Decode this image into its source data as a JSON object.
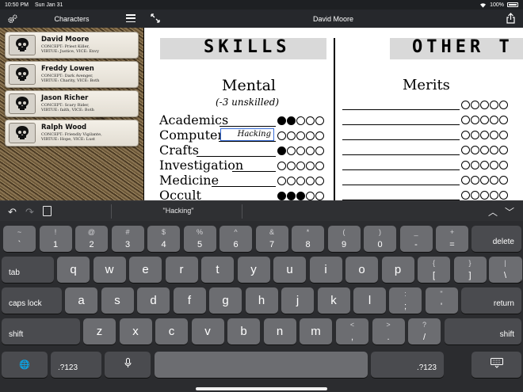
{
  "status_bar": {
    "time": "10:50 PM",
    "date": "Sun Jan 31",
    "battery": "100%"
  },
  "sidebar": {
    "title": "Characters",
    "characters": [
      {
        "name": "David Moore",
        "line1": "CONCEPT: Priest Killer,",
        "line2": "VIRTUE: Justice, VICE: Envy"
      },
      {
        "name": "Freddy Lowen",
        "line1": "CONCEPT: Dark Avenger,",
        "line2": "VIRTUE: Charity, VICE: Both"
      },
      {
        "name": "Jason Richer",
        "line1": "CONCEPT: Scary Rider,",
        "line2": "VIRTUE: faith, VICE: Both"
      },
      {
        "name": "Ralph Wood",
        "line1": "CONCEPT: Friendly Vigilante,",
        "line2": "VIRTUE: Hope, VICE: Lust"
      }
    ]
  },
  "main": {
    "title": "David Moore",
    "sheet": {
      "skills_banner": "SKILLS",
      "other_banner": "OTHER T",
      "mental_title": "Mental",
      "mental_subtitle": "(-3 unskilled)",
      "skills": [
        {
          "name": "Academics",
          "rating": 2
        },
        {
          "name": "Computer",
          "rating": 0,
          "specialty": "Hacking"
        },
        {
          "name": "Crafts",
          "rating": 1
        },
        {
          "name": "Investigation",
          "rating": 0
        },
        {
          "name": "Medicine",
          "rating": 0
        },
        {
          "name": "Occult",
          "rating": 3
        }
      ],
      "merits_title": "Merits",
      "merit_rows": 7
    }
  },
  "keyboard": {
    "suggestion": "\"Hacking\"",
    "row1": [
      {
        "top": "~",
        "bot": "`"
      },
      {
        "top": "!",
        "bot": "1"
      },
      {
        "top": "@",
        "bot": "2"
      },
      {
        "top": "#",
        "bot": "3"
      },
      {
        "top": "$",
        "bot": "4"
      },
      {
        "top": "%",
        "bot": "5"
      },
      {
        "top": "^",
        "bot": "6"
      },
      {
        "top": "&",
        "bot": "7"
      },
      {
        "top": "*",
        "bot": "8"
      },
      {
        "top": "(",
        "bot": "9"
      },
      {
        "top": ")",
        "bot": "0"
      },
      {
        "top": "_",
        "bot": "-"
      },
      {
        "top": "+",
        "bot": "="
      }
    ],
    "delete_label": "delete",
    "tab_label": "tab",
    "row2": [
      "q",
      "w",
      "e",
      "r",
      "t",
      "y",
      "u",
      "i",
      "o",
      "p"
    ],
    "row2_symbols": [
      {
        "top": "{",
        "bot": "["
      },
      {
        "top": "}",
        "bot": "]"
      },
      {
        "top": "|",
        "bot": "\\"
      }
    ],
    "caps_label": "caps lock",
    "row3": [
      "a",
      "s",
      "d",
      "f",
      "g",
      "h",
      "j",
      "k",
      "l"
    ],
    "row3_symbols": [
      {
        "top": ":",
        "bot": ";"
      },
      {
        "top": "\"",
        "bot": "'"
      }
    ],
    "return_label": "return",
    "shift_label": "shift",
    "row4": [
      "z",
      "x",
      "c",
      "v",
      "b",
      "n",
      "m"
    ],
    "row4_symbols": [
      {
        "top": "<",
        "bot": ","
      },
      {
        "top": ">",
        "bot": "."
      },
      {
        "top": "?",
        "bot": "/"
      }
    ],
    "numbers_label": ".?123"
  }
}
